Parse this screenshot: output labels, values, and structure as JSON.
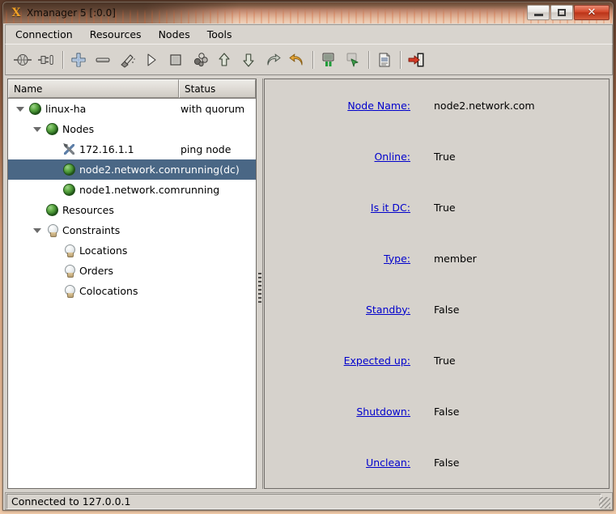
{
  "window": {
    "title": "Xmanager 5 [:0.0]",
    "app_icon": "X",
    "controls": {
      "minimize": "–",
      "maximize": "□",
      "close": "✕"
    }
  },
  "menubar": {
    "items": [
      {
        "label": "Connection"
      },
      {
        "label": "Resources"
      },
      {
        "label": "Nodes"
      },
      {
        "label": "Tools"
      }
    ]
  },
  "toolbar": {
    "buttons": [
      {
        "icon": "connect-icon",
        "name": "connect"
      },
      {
        "icon": "disconnect-icon",
        "name": "disconnect"
      },
      {
        "icon": "add-icon",
        "name": "add"
      },
      {
        "icon": "remove-icon",
        "name": "remove"
      },
      {
        "icon": "cleanup-brush-icon",
        "name": "cleanup"
      },
      {
        "icon": "start-play-icon",
        "name": "start"
      },
      {
        "icon": "stop-square-icon",
        "name": "stop"
      },
      {
        "icon": "migrate-icon",
        "name": "migrate"
      },
      {
        "icon": "arrow-up-icon",
        "name": "move-up"
      },
      {
        "icon": "arrow-down-icon",
        "name": "move-down"
      },
      {
        "icon": "redo-icon",
        "name": "redo"
      },
      {
        "icon": "undo-icon",
        "name": "undo"
      },
      {
        "icon": "node-standby-icon",
        "name": "standby"
      },
      {
        "icon": "node-offline-icon",
        "name": "offline"
      },
      {
        "icon": "properties-doc-icon",
        "name": "properties"
      },
      {
        "icon": "exit-door-icon",
        "name": "exit"
      }
    ]
  },
  "tree": {
    "columns": [
      "Name",
      "Status"
    ],
    "rows": [
      {
        "name": "linux-ha",
        "status": "with quorum",
        "indent": 0,
        "icon": "green-ball-icon",
        "arrow": "down",
        "selected": false
      },
      {
        "name": "Nodes",
        "status": "",
        "indent": 1,
        "icon": "green-ball-icon",
        "arrow": "down",
        "selected": false
      },
      {
        "name": "172.16.1.1",
        "status": "ping node",
        "indent": 2,
        "icon": "tools-icon",
        "arrow": "none",
        "selected": false
      },
      {
        "name": "node2.network.com",
        "status": "running(dc)",
        "indent": 2,
        "icon": "green-ball-icon",
        "arrow": "none",
        "selected": true
      },
      {
        "name": "node1.network.com",
        "status": "running",
        "indent": 2,
        "icon": "green-ball-icon",
        "arrow": "none",
        "selected": false
      },
      {
        "name": "Resources",
        "status": "",
        "indent": 1,
        "icon": "green-ball-icon",
        "arrow": "none",
        "selected": false
      },
      {
        "name": "Constraints",
        "status": "",
        "indent": 1,
        "icon": "bulb-icon",
        "arrow": "down",
        "selected": false
      },
      {
        "name": "Locations",
        "status": "",
        "indent": 2,
        "icon": "bulb-icon",
        "arrow": "none",
        "selected": false
      },
      {
        "name": "Orders",
        "status": "",
        "indent": 2,
        "icon": "bulb-icon",
        "arrow": "none",
        "selected": false
      },
      {
        "name": "Colocations",
        "status": "",
        "indent": 2,
        "icon": "bulb-icon",
        "arrow": "none",
        "selected": false
      }
    ],
    "selection_color": "#4a6785"
  },
  "detail": {
    "fields": [
      {
        "label": "Node Name:",
        "value": "node2.network.com"
      },
      {
        "label": "Online:",
        "value": "True"
      },
      {
        "label": "Is it DC:",
        "value": "True"
      },
      {
        "label": "Type:",
        "value": "member"
      },
      {
        "label": "Standby:",
        "value": "False"
      },
      {
        "label": "Expected up:",
        "value": "True"
      },
      {
        "label": "Shutdown:",
        "value": "False"
      },
      {
        "label": "Unclean:",
        "value": "False"
      }
    ],
    "label_color": "#0000cc"
  },
  "statusbar": {
    "text": "Connected to 127.0.0.1"
  }
}
